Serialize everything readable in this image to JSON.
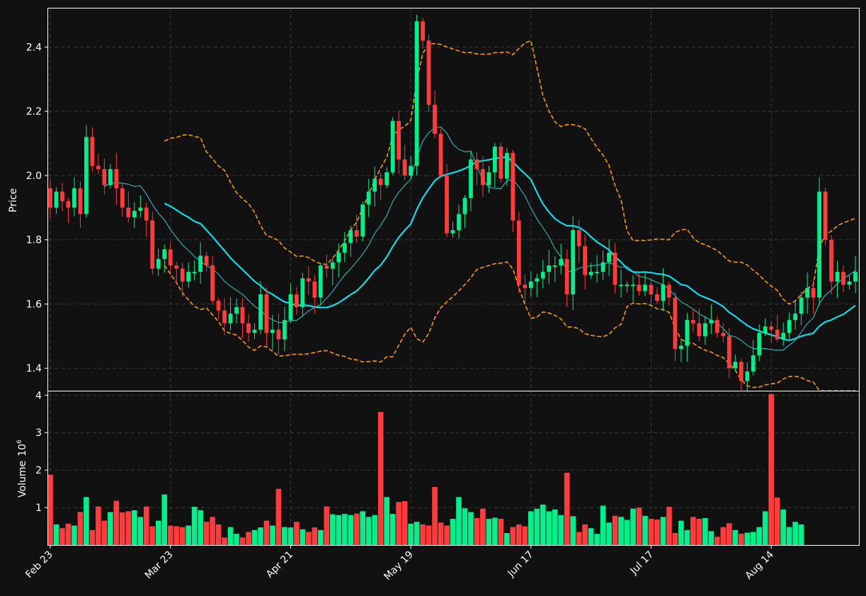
{
  "chart_data": [
    {
      "type": "candlestick",
      "ylabel": "Price",
      "ylim": [
        1.33,
        2.52
      ],
      "yticks": [
        "1.4",
        "1.6",
        "1.8",
        "2.0",
        "2.2",
        "2.4"
      ],
      "xlabels": [
        "Feb 23",
        "Mar 23",
        "Apr 21",
        "May 19",
        "Jun 17",
        "Jul 17",
        "Aug 14"
      ],
      "xlabel_index": [
        0,
        20,
        40,
        60,
        80,
        100,
        120
      ],
      "grid": true,
      "colors": {
        "background": "#111111",
        "up": "#00f08c",
        "down": "#ff3b3b",
        "ma_fast": "#33cccc",
        "ma_slow": "#00eeff",
        "bands": "#ff9900",
        "grid": "#3a3a3a",
        "frame": "#ffffff"
      },
      "close": [
        1.9,
        1.95,
        1.92,
        1.9,
        1.96,
        1.88,
        2.12,
        2.03,
        2.02,
        1.97,
        2.02,
        1.96,
        1.9,
        1.87,
        1.89,
        1.9,
        1.86,
        1.71,
        1.74,
        1.77,
        1.72,
        1.71,
        1.67,
        1.7,
        1.7,
        1.75,
        1.72,
        1.61,
        1.58,
        1.54,
        1.57,
        1.59,
        1.54,
        1.51,
        1.52,
        1.63,
        1.51,
        1.52,
        1.49,
        1.55,
        1.63,
        1.59,
        1.68,
        1.67,
        1.62,
        1.72,
        1.71,
        1.73,
        1.76,
        1.79,
        1.83,
        1.81,
        1.91,
        1.95,
        1.99,
        1.97,
        2.01,
        2.17,
        2.05,
        2.0,
        2.03,
        2.48,
        2.42,
        2.22,
        2.13,
        2.0,
        1.82,
        1.83,
        1.88,
        1.93,
        2.05,
        2.02,
        1.97,
        2.01,
        2.09,
        1.99,
        2.07,
        1.86,
        1.66,
        1.65,
        1.67,
        1.68,
        1.7,
        1.72,
        1.72,
        1.74,
        1.63,
        1.83,
        1.78,
        1.69,
        1.7,
        1.7,
        1.73,
        1.76,
        1.66,
        1.66,
        1.66,
        1.66,
        1.64,
        1.66,
        1.63,
        1.61,
        1.66,
        1.62,
        1.46,
        1.47,
        1.55,
        1.54,
        1.5,
        1.54,
        1.55,
        1.51,
        1.5,
        1.4,
        1.42,
        1.36,
        1.39,
        1.44,
        1.51,
        1.53,
        1.52,
        1.49,
        1.51,
        1.55,
        1.57,
        1.62,
        1.65,
        1.62,
        1.95,
        1.8,
        1.67,
        1.7,
        1.66,
        1.67,
        1.7
      ],
      "volume_panel": {
        "ylabel": "Volume",
        "yunit": "10",
        "yunit_exp": "6",
        "ylim": [
          0,
          4.1
        ],
        "yticks": [
          "1",
          "2",
          "3",
          "4"
        ],
        "volume": [
          1.88,
          0.55,
          0.45,
          0.57,
          0.52,
          0.88,
          1.28,
          0.4,
          1.03,
          0.65,
          0.88,
          1.18,
          0.87,
          0.9,
          0.93,
          0.75,
          1.03,
          0.5,
          0.65,
          1.35,
          0.52,
          0.5,
          0.48,
          0.52,
          1.02,
          0.93,
          0.62,
          0.75,
          0.55,
          0.2,
          0.48,
          0.3,
          0.2,
          0.35,
          0.4,
          0.47,
          0.65,
          0.52,
          1.5,
          0.48,
          0.47,
          0.62,
          0.42,
          0.35,
          0.47,
          0.4,
          1.03,
          0.82,
          0.8,
          0.83,
          0.8,
          0.84,
          0.9,
          0.75,
          0.8,
          3.55,
          1.28,
          0.83,
          1.15,
          1.17,
          0.57,
          0.62,
          0.55,
          0.52,
          1.55,
          0.6,
          0.52,
          0.7,
          1.28,
          0.98,
          0.88,
          0.72,
          0.97,
          0.7,
          0.73,
          0.7,
          0.32,
          0.48,
          0.55,
          0.5,
          0.9,
          0.97,
          1.08,
          0.9,
          0.95,
          0.8,
          1.93,
          0.77,
          0.35,
          0.55,
          0.45,
          0.3,
          1.05,
          0.6,
          0.78,
          0.75,
          0.67,
          0.97,
          1.0,
          0.78,
          0.7,
          0.68,
          0.75,
          1.02,
          0.32,
          0.65,
          0.4,
          0.75,
          0.7,
          0.72,
          0.37,
          0.22,
          0.48,
          0.58,
          0.4,
          0.3,
          0.33,
          0.35,
          0.48,
          0.9,
          4.03,
          1.27,
          0.95,
          0.48,
          0.62,
          0.55
        ]
      }
    }
  ]
}
